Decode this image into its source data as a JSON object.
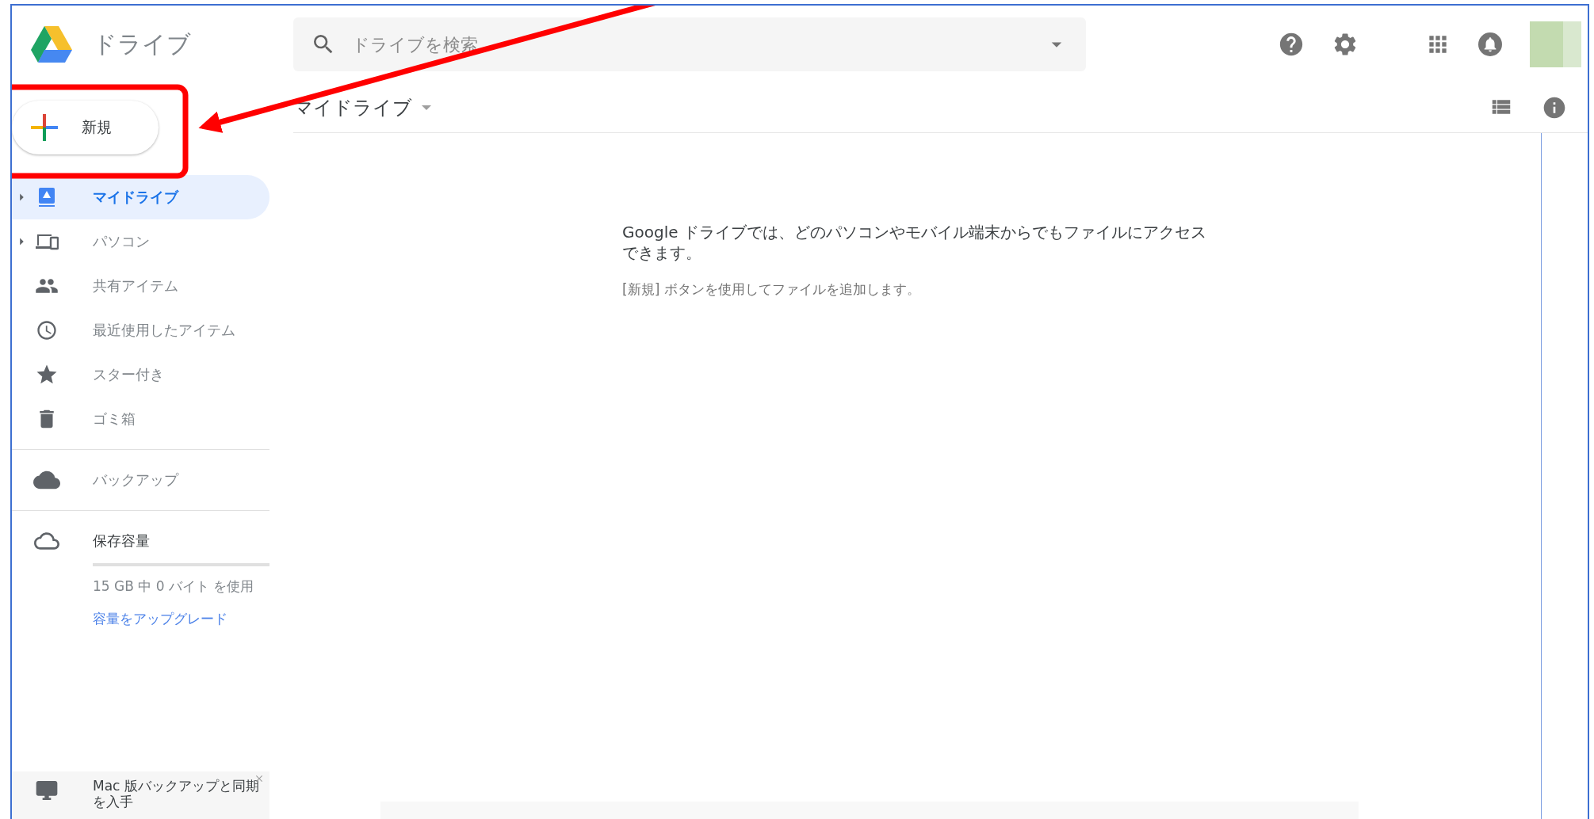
{
  "app": {
    "name": "ドライブ"
  },
  "search": {
    "placeholder": "ドライブを検索"
  },
  "new_button": {
    "label": "新規"
  },
  "sidebar": {
    "sections": [
      {
        "items": [
          {
            "kind": "my-drive",
            "label": "マイドライブ",
            "selected": true,
            "expandable": true
          },
          {
            "kind": "computers",
            "label": "パソコン",
            "selected": false,
            "expandable": true
          },
          {
            "kind": "shared",
            "label": "共有アイテム",
            "selected": false,
            "expandable": false
          },
          {
            "kind": "recent",
            "label": "最近使用したアイテム",
            "selected": false,
            "expandable": false
          },
          {
            "kind": "starred",
            "label": "スター付き",
            "selected": false,
            "expandable": false
          },
          {
            "kind": "trash",
            "label": "ゴミ箱",
            "selected": false,
            "expandable": false
          }
        ]
      },
      {
        "items": [
          {
            "kind": "backup",
            "label": "バックアップ",
            "selected": false,
            "expandable": false
          }
        ]
      }
    ]
  },
  "storage": {
    "label": "保存容量",
    "level": 0,
    "usage": "15 GB 中 0 バイト を使用",
    "upgrade_link": "容量をアップグレード"
  },
  "promo": {
    "text": "Mac 版バックアップと同期を入手"
  },
  "toolbar": {
    "title": "マイドライブ"
  },
  "empty_state": {
    "message": "Google ドライブでは、どのパソコンやモバイル端末からでもファイルにアクセスできます。",
    "hint": "[新規] ボタンを使用してファイルを追加します。"
  }
}
